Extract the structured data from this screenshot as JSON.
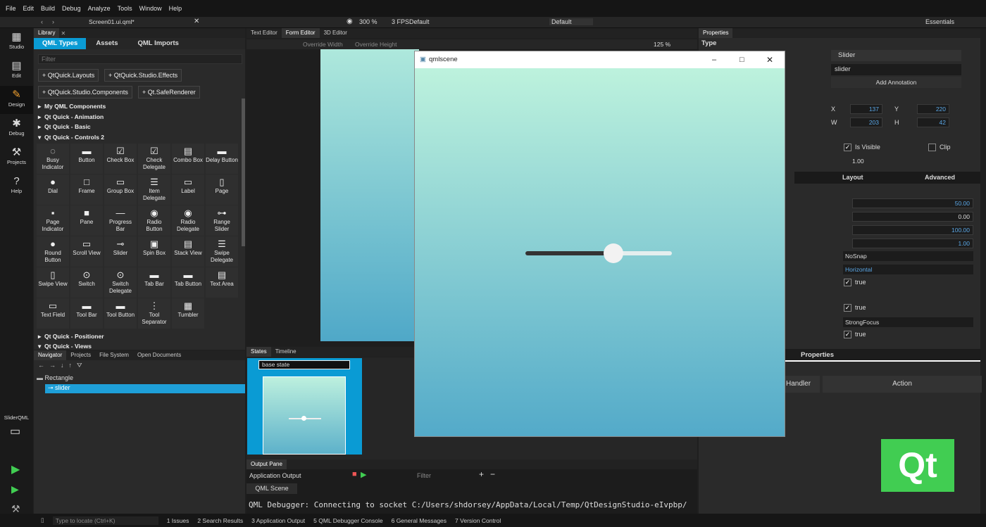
{
  "menu": [
    "File",
    "Edit",
    "Build",
    "Debug",
    "Analyze",
    "Tools",
    "Window",
    "Help"
  ],
  "toolbar": {
    "file": "Screen01.ui.qml*",
    "zoom": "300 %",
    "fps": "3 FPS",
    "fps_mode": "Default",
    "style": "Default",
    "workspace": "Essentials"
  },
  "modes": [
    {
      "label": "Studio",
      "icon": "grid-icon"
    },
    {
      "label": "Edit",
      "icon": "document-icon"
    },
    {
      "label": "Design",
      "icon": "pencil-icon"
    },
    {
      "label": "Debug",
      "icon": "bug-icon"
    },
    {
      "label": "Projects",
      "icon": "wrench-icon"
    },
    {
      "label": "Help",
      "icon": "help-icon"
    }
  ],
  "kit": "SliderQML",
  "library": {
    "title": "Library",
    "tabs": [
      "QML Types",
      "Assets",
      "QML Imports"
    ],
    "filter_placeholder": "Filter",
    "imports": [
      "QtQuick.Layouts",
      "QtQuick.Studio.Effects",
      "QtQuick.Studio.Components",
      "Qt.SafeRenderer"
    ],
    "tree": [
      "My QML Components",
      "Qt Quick - Animation",
      "Qt Quick - Basic",
      "Qt Quick - Controls 2"
    ],
    "tree_bottom": [
      "Qt Quick - Positioner",
      "Qt Quick - Views"
    ],
    "items": [
      [
        "Busy Indicator",
        "Button",
        "Check Box",
        "Check Delegate",
        "Combo Box",
        "Delay Button"
      ],
      [
        "Dial",
        "Frame",
        "Group Box",
        "Item Delegate",
        "Label",
        "Page"
      ],
      [
        "Page Indicator",
        "Pane",
        "Progress Bar",
        "Radio Button",
        "Radio Delegate",
        "Range Slider"
      ],
      [
        "Round Button",
        "Scroll View",
        "Slider",
        "Spin Box",
        "Stack View",
        "Swipe Delegate"
      ],
      [
        "Swipe View",
        "Switch",
        "Switch Delegate",
        "Tab Bar",
        "Tab Button",
        "Text Area"
      ],
      [
        "Text Field",
        "Tool Bar",
        "Tool Button",
        "Tool Separator",
        "Tumbler",
        ""
      ]
    ]
  },
  "navigator": {
    "tabs": [
      "Navigator",
      "Projects",
      "File System",
      "Open Documents"
    ],
    "nodes": [
      "Rectangle",
      "slider"
    ]
  },
  "editor": {
    "tabs": [
      "Text Editor",
      "Form Editor",
      "3D Editor"
    ],
    "override_width": "Override Width",
    "override_height": "Override Height",
    "zoom": "125 %"
  },
  "states": {
    "tabs": [
      "States",
      "Timeline"
    ],
    "base_state": "base state"
  },
  "output": {
    "tab": "Output Pane",
    "app_output": "Application Output",
    "filter": "Filter",
    "run_tab": "QML Scene",
    "log": "QML Debugger: Connecting to socket C:/Users/shdorsey/AppData/Local/Temp/QtDesignStudio-eIvpbp/"
  },
  "qmlscene": {
    "title": "qmlscene",
    "slider_value": 0.6
  },
  "properties": {
    "title": "Properties",
    "section": "Type",
    "type": "Slider",
    "id": "slider",
    "annotation": "Add Annotation",
    "x": "137",
    "y": "220",
    "w": "203",
    "h": "42",
    "visible": "Is Visible",
    "clip": "Clip",
    "opacity": "1.00",
    "tabs": [
      "Layout",
      "Advanced"
    ],
    "values": [
      "50.00",
      "0.00",
      "100.00",
      "1.00"
    ],
    "snap": "NoSnap",
    "orientation": "Horizontal",
    "true_label": "true",
    "focus": "StrongFocus",
    "tab_properties": "Properties",
    "handler": "Handler",
    "action": "Action"
  },
  "logo": "Qt",
  "status": {
    "locate": "Type to locate (Ctrl+K)",
    "items": [
      "1  Issues",
      "2  Search Results",
      "3  Application Output",
      "5  QML Debugger Console",
      "6  General Messages",
      "7  Version Control"
    ]
  },
  "colors": {
    "accent": "#0a9bd4",
    "qt_green": "#41cd52",
    "selected": "#1e9fd8"
  }
}
